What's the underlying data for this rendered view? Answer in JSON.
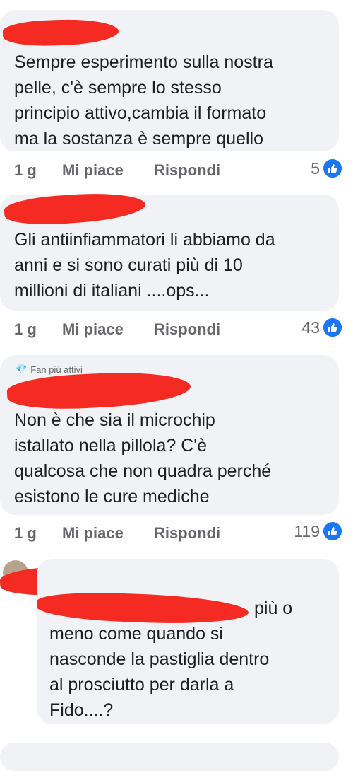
{
  "comments": [
    {
      "text_lines": [
        "Sempre esperimento sulla nostra",
        "pelle, c'è sempre lo stesso",
        "principio attivo,cambia il formato",
        "ma la sostanza è sempre quello"
      ],
      "time": "1 g",
      "like_label": "Mi piace",
      "reply_label": "Rispondi",
      "reactions": "5"
    },
    {
      "text_lines": [
        "Gli antiinfiammatori li abbiamo da",
        "anni e si sono curati più di 10",
        "millioni di italiani ....ops..."
      ],
      "time": "1 g",
      "like_label": "Mi piace",
      "reply_label": "Rispondi",
      "reactions": "43"
    },
    {
      "badge": "Fan più attivi",
      "text_lines": [
        "Non è che sia il microchip",
        "istallato nella pillola? C'è",
        "qualcosa che non quadra perché",
        "esistono  le cure mediche"
      ],
      "time": "1 g",
      "like_label": "Mi piace",
      "reply_label": "Rispondi",
      "reactions": "119"
    },
    {
      "text_lines": [
        "più o",
        "meno come quando si",
        "nasconde la pastiglia dentro",
        "al prosciutto per darla a",
        "Fido....?"
      ]
    }
  ],
  "colors": {
    "bubble": "#f0f2f5",
    "redaction": "#f52a22",
    "like_blue": "#1877f2",
    "meta_gray": "#65676b"
  }
}
